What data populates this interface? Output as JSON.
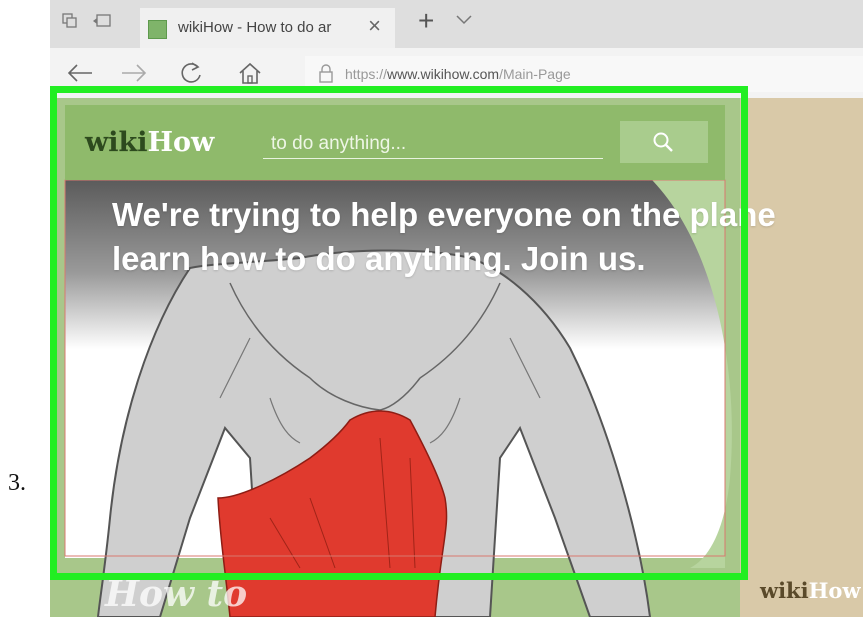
{
  "step": {
    "number": "3."
  },
  "browser": {
    "tab": {
      "title": "wikiHow - How to do ar"
    },
    "address_bar": {
      "url_prefix": "https://",
      "url_host": "www.wikihow.com",
      "url_path": "/Main-Page"
    }
  },
  "site": {
    "logo_wiki": "wiki",
    "logo_how": "How",
    "search_placeholder": "to do anything...",
    "hero_line1": "We're trying to help everyone on the plane",
    "hero_line2": "learn how to do anything. Join us.",
    "footer_howto": "How to",
    "footer_logo_wiki": "wiki",
    "footer_logo_how": "How"
  },
  "colors": {
    "highlight": "#22ee22",
    "header_green": "#8fba6b",
    "muscle_red": "#e03a2e"
  }
}
